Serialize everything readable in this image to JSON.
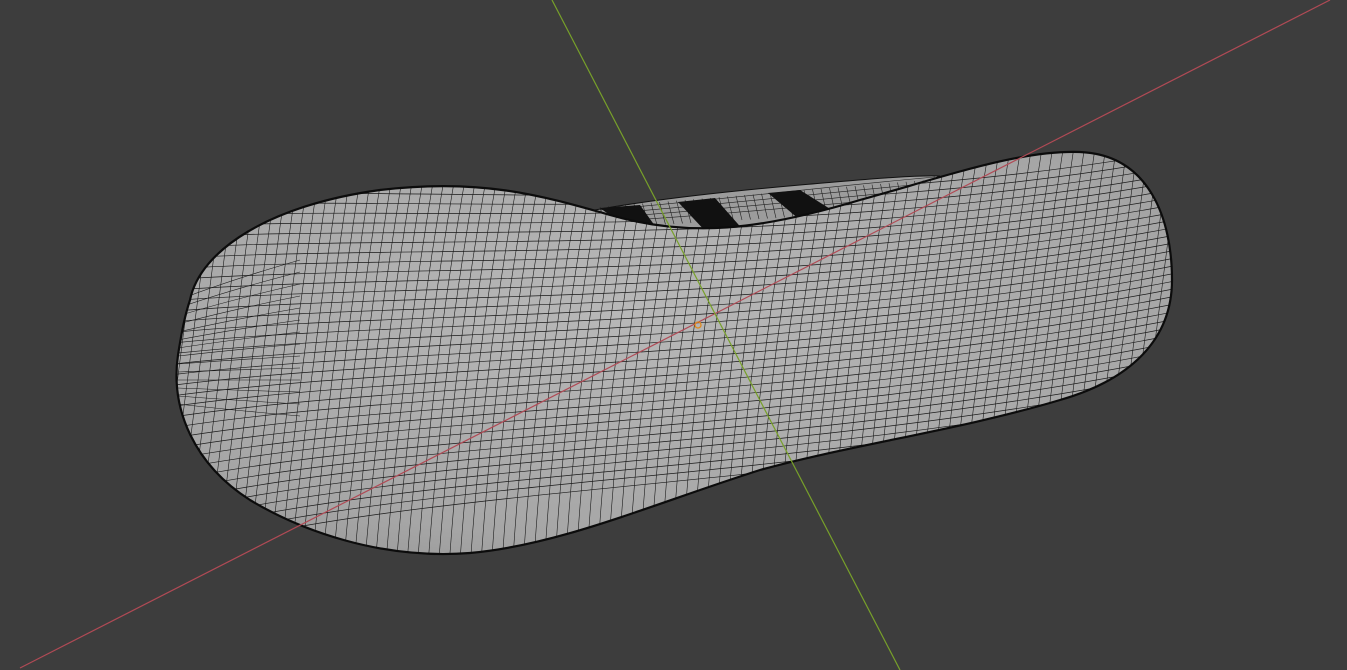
{
  "viewport": {
    "background": "#3d3d3d",
    "mesh_fill": "#a8a8a8",
    "mesh_fill_light": "#b6b6b6",
    "mesh_wire": "#1a1a1a",
    "mesh_outline": "#0c0c0c",
    "stripe_color": "#101010",
    "x_axis_color": "#b04a55",
    "y_axis_color": "#77a02a",
    "origin_color": "#e08a1e"
  },
  "objects": [
    {
      "name": "shoe-sole",
      "type": "mesh",
      "display": "wireframe-overlay"
    }
  ],
  "axes": [
    {
      "name": "x-axis",
      "color_key": "x_axis_color"
    },
    {
      "name": "y-axis",
      "color_key": "y_axis_color"
    }
  ],
  "origin": {
    "icon": "object-origin-dot"
  }
}
